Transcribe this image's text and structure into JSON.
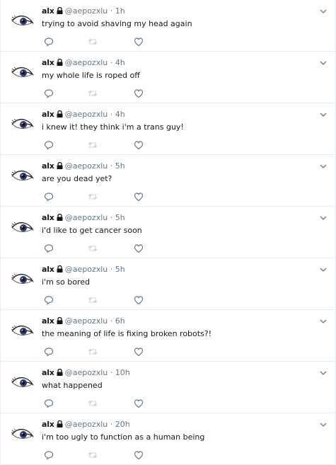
{
  "colors": {
    "text": "#14171a",
    "meta": "#657786",
    "border": "#e6ecf0",
    "icon": "#657786",
    "disabled": "#c4ced6"
  },
  "tweets": [
    {
      "name": "alx",
      "handle": "@aepozxlu",
      "sep": "·",
      "time": "1h",
      "text": "trying to avoid shaving my head again"
    },
    {
      "name": "alx",
      "handle": "@aepozxlu",
      "sep": "·",
      "time": "4h",
      "text": "my whole life is roped off"
    },
    {
      "name": "alx",
      "handle": "@aepozxlu",
      "sep": "·",
      "time": "4h",
      "text": "i knew it!  they think i'm a trans guy!"
    },
    {
      "name": "alx",
      "handle": "@aepozxlu",
      "sep": "·",
      "time": "5h",
      "text": "are you dead yet?"
    },
    {
      "name": "alx",
      "handle": "@aepozxlu",
      "sep": "·",
      "time": "5h",
      "text": "i'd like to get cancer soon"
    },
    {
      "name": "alx",
      "handle": "@aepozxlu",
      "sep": "·",
      "time": "5h",
      "text": "i'm so bored"
    },
    {
      "name": "alx",
      "handle": "@aepozxlu",
      "sep": "·",
      "time": "6h",
      "text": "the meaning of life is fixing broken robots?!"
    },
    {
      "name": "alx",
      "handle": "@aepozxlu",
      "sep": "·",
      "time": "10h",
      "text": "what happened"
    },
    {
      "name": "alx",
      "handle": "@aepozxlu",
      "sep": "·",
      "time": "20h",
      "text": "i'm too ugly to function as a human being"
    }
  ]
}
